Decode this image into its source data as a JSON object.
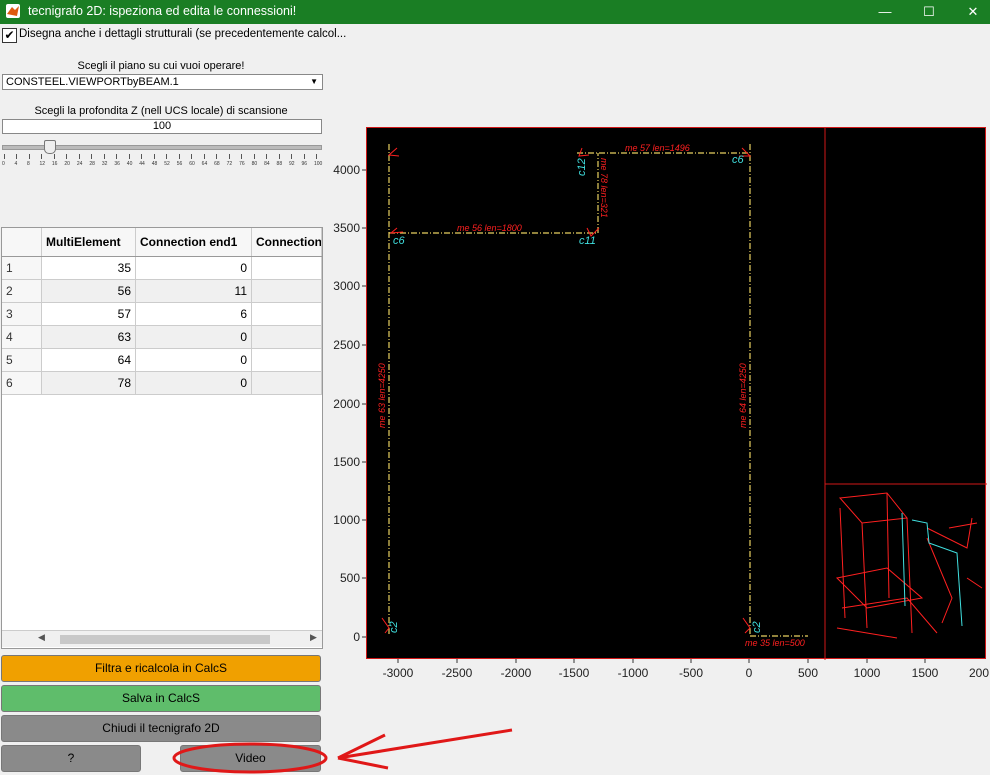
{
  "window": {
    "title": "tecnigrafo 2D: ispeziona ed edita le connessioni!",
    "minimize": "—",
    "maximize": "☐",
    "close": "✕"
  },
  "options": {
    "checkbox_label": "Disegna anche i dettagli strutturali (se precedentemente calcol...",
    "checkbox_checked": true,
    "plane_prompt": "Scegli il piano su cui vuoi operare!",
    "plane_selected": "CONSTEEL.VIEWPORTbyBEAM.1",
    "depth_prompt": "Scegli la profondita Z (nell UCS locale) di scansione",
    "depth_value": "100",
    "slider_ticks": [
      "0",
      "4",
      "8",
      "12",
      "16",
      "20",
      "24",
      "28",
      "32",
      "36",
      "40",
      "44",
      "48",
      "52",
      "56",
      "60",
      "64",
      "68",
      "72",
      "76",
      "80",
      "84",
      "88",
      "92",
      "96",
      "100"
    ]
  },
  "table": {
    "headers": [
      "",
      "MultiElement",
      "Connection end1",
      "Connection"
    ],
    "rows": [
      {
        "idx": "1",
        "multi": "35",
        "conn1": "0"
      },
      {
        "idx": "2",
        "multi": "56",
        "conn1": "11"
      },
      {
        "idx": "3",
        "multi": "57",
        "conn1": "6"
      },
      {
        "idx": "4",
        "multi": "63",
        "conn1": "0"
      },
      {
        "idx": "5",
        "multi": "64",
        "conn1": "0"
      },
      {
        "idx": "6",
        "multi": "78",
        "conn1": "0"
      }
    ]
  },
  "buttons": {
    "filter": "Filtra e ricalcola in CalcS",
    "save": "Salva in CalcS",
    "close": "Chiudi il tecnigrafo 2D",
    "help": "?",
    "video": "Video"
  },
  "colors": {
    "titlebar": "#1a7e24",
    "filter_btn": "#f0a000",
    "save_btn": "#5fbd6b",
    "gray_btn": "#8a8a8a",
    "plot_bg": "#000000",
    "plot_border": "#d01818",
    "beam_line": "#e8d060",
    "label_red": "#ff2020",
    "label_cyan": "#40e0e0",
    "arrow_red": "#e01818"
  },
  "plot": {
    "x_ticks": [
      "-3000",
      "-2500",
      "-2000",
      "-1500",
      "-1000",
      "-500",
      "0",
      "500",
      "1000",
      "1500",
      "200"
    ],
    "y_ticks": [
      "4000",
      "3500",
      "3000",
      "2500",
      "2000",
      "1500",
      "1000",
      "500",
      "0"
    ],
    "beam_labels": [
      "me 57 len=1496",
      "me 56 len=1800",
      "me 78 len=321",
      "me 63 len=4250",
      "me 64 len=4250",
      "me 35 len=500"
    ],
    "conn_labels": [
      "c12",
      "c6",
      "c6",
      "c11",
      "c2",
      "c2"
    ]
  }
}
